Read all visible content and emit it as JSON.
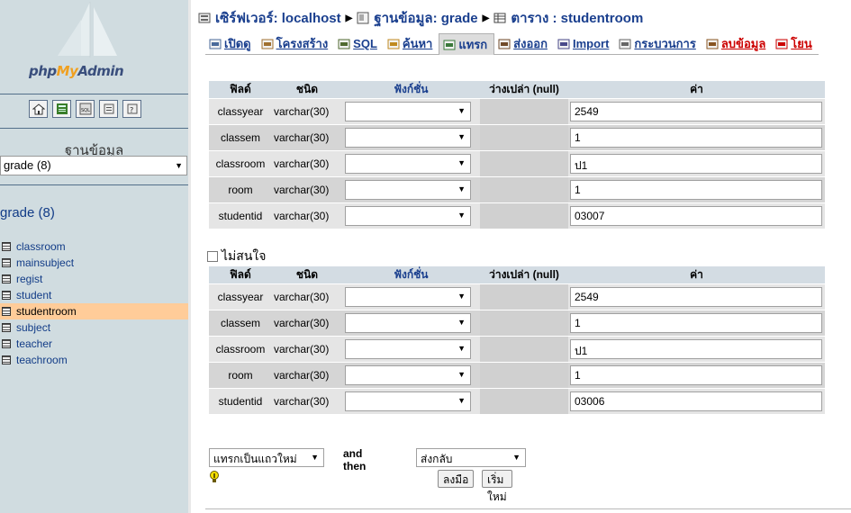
{
  "left": {
    "logo_prefix": "php",
    "logo_my": "My",
    "logo_suffix": "Admin",
    "icon_buttons": [
      "home-icon",
      "query-window-icon",
      "sql-icon",
      "docs-icon",
      "help-icon"
    ],
    "db_label": "ฐานข้อมูล",
    "db_select": "grade (8)",
    "db_heading": "grade (8)",
    "tables": [
      "classroom",
      "mainsubject",
      "regist",
      "student",
      "studentroom",
      "subject",
      "teacher",
      "teachroom"
    ],
    "selected_table": "studentroom"
  },
  "breadcrumb": {
    "server": "เซิร์ฟเวอร์: localhost",
    "database": "ฐานข้อมูล: grade",
    "table": "ตาราง : studentroom"
  },
  "tabs": [
    {
      "label": "เปิดดู",
      "icon": "browse-icon"
    },
    {
      "label": "โครงสร้าง",
      "icon": "structure-icon"
    },
    {
      "label": "SQL",
      "icon": "sql-icon"
    },
    {
      "label": "ค้นหา",
      "icon": "search-icon"
    },
    {
      "label": "แทรก",
      "icon": "insert-icon"
    },
    {
      "label": "ส่งออก",
      "icon": "export-icon"
    },
    {
      "label": "Import",
      "icon": "import-icon"
    },
    {
      "label": "กระบวนการ",
      "icon": "operations-icon"
    },
    {
      "label": "ลบข้อมูล",
      "icon": "empty-icon"
    },
    {
      "label": "โยน",
      "icon": "drop-icon"
    }
  ],
  "headers": {
    "field": "ฟิลด์",
    "type": "ชนิด",
    "function": "ฟังก์ชั่น",
    "null": "ว่างเปล่า (null)",
    "value": "ค่า"
  },
  "rows1": [
    {
      "field": "classyear",
      "type": "varchar(30)",
      "value": "2549"
    },
    {
      "field": "classem",
      "type": "varchar(30)",
      "value": "1"
    },
    {
      "field": "classroom",
      "type": "varchar(30)",
      "value": "ป1"
    },
    {
      "field": "room",
      "type": "varchar(30)",
      "value": "1"
    },
    {
      "field": "studentid",
      "type": "varchar(30)",
      "value": "03007"
    }
  ],
  "ignore_label": "ไม่สนใจ",
  "rows2": [
    {
      "field": "classyear",
      "type": "varchar(30)",
      "value": "2549"
    },
    {
      "field": "classem",
      "type": "varchar(30)",
      "value": "1"
    },
    {
      "field": "classroom",
      "type": "varchar(30)",
      "value": "ป1"
    },
    {
      "field": "room",
      "type": "varchar(30)",
      "value": "1"
    },
    {
      "field": "studentid",
      "type": "varchar(30)",
      "value": "03006"
    }
  ],
  "bottom": {
    "insert_mode": "แทรกเป็นแถวใหม่",
    "and_then": "and then",
    "after": "ส่งกลับ",
    "go_button": "ลงมือ",
    "reset_button": "เริ่มใหม่"
  }
}
